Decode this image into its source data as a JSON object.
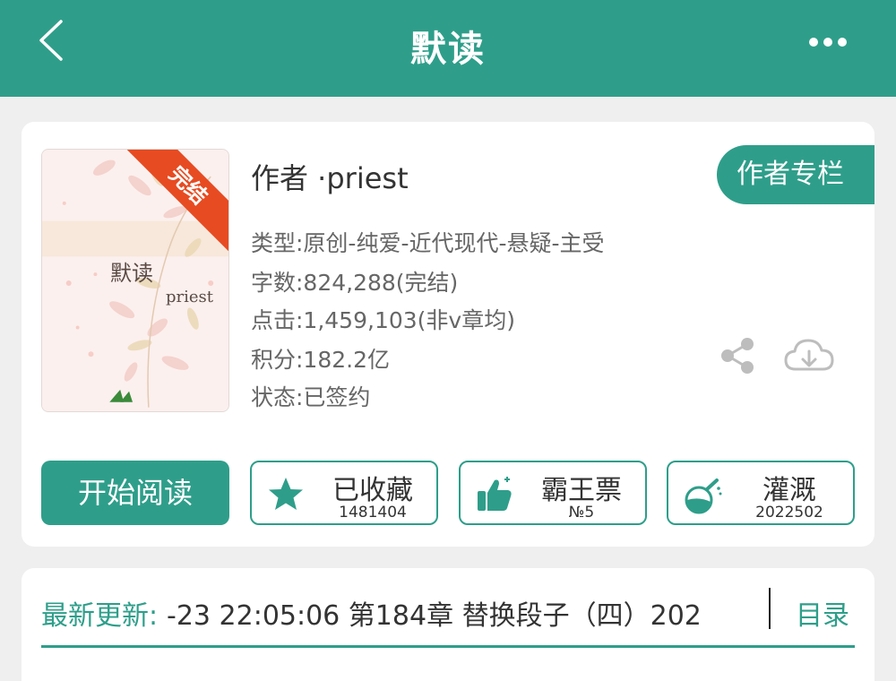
{
  "header": {
    "title": "默读",
    "back_icon": "chevron-left-icon",
    "more_icon": "more-horizontal-icon",
    "bg_color": "#2e9e8a"
  },
  "book": {
    "cover": {
      "title": "默读",
      "author": "priest",
      "ribbon": "完结"
    },
    "author_line": "作者 ·priest",
    "author_column_btn": "作者专栏",
    "meta": {
      "type": "类型:原创-纯爱-近代现代-悬疑-主受",
      "words": "字数:824,288(完结)",
      "clicks": "点击:1,459,103(非v章均)",
      "score": "积分:182.2亿",
      "status": "状态:已签约"
    },
    "share_icon": "share-icon",
    "download_icon": "cloud-download-icon"
  },
  "actions": {
    "start_label": "开始阅读",
    "favorite": {
      "label": "已收藏",
      "value": "1481404",
      "icon": "star-icon"
    },
    "vote": {
      "label": "霸王票",
      "value": "№5",
      "icon": "thumbs-up-icon"
    },
    "water": {
      "label": "灌溉",
      "value": "2022502",
      "icon": "flask-icon"
    }
  },
  "update": {
    "label": "最新更新:",
    "text": "-23 22:05:06  第184章 替换段子（四）202",
    "toc_label": "目录"
  },
  "colors": {
    "accent": "#2e9e8a",
    "ribbon": "#e74b22"
  }
}
